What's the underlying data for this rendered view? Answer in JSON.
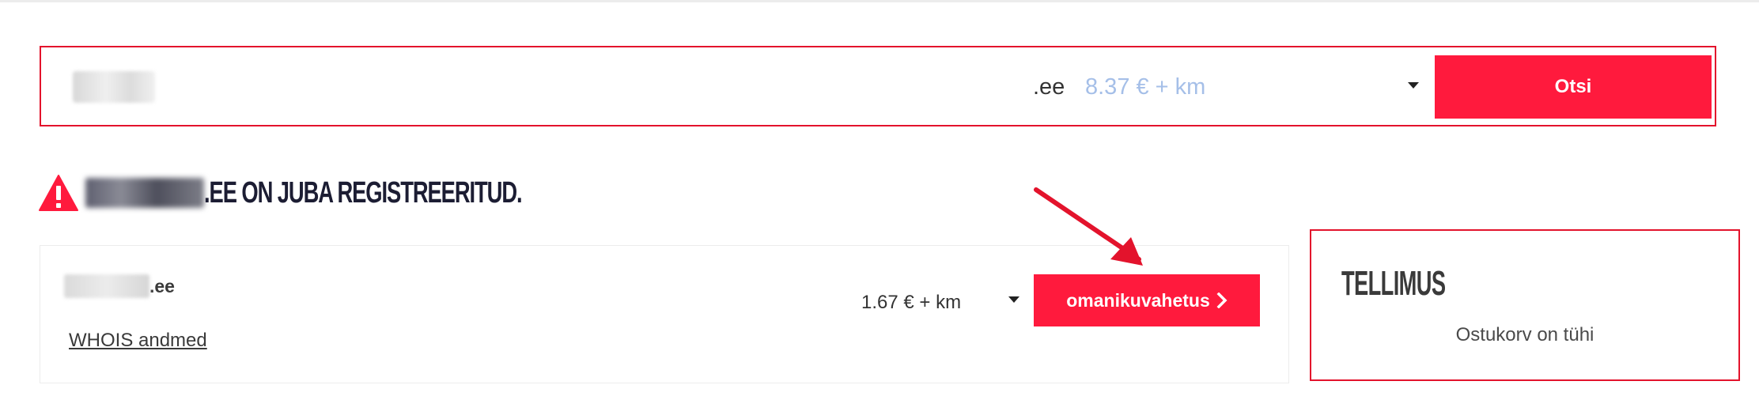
{
  "search": {
    "tld": ".ee",
    "tld_price": "8.37 € + km",
    "button_label": "Otsi"
  },
  "result": {
    "heading_suffix": ".EE ON JUBA REGISTREERITUD.",
    "domain_tld": ".ee",
    "whois_link": "WHOIS andmed",
    "price": "1.67 € + km",
    "action_label": "omanikuvahetus"
  },
  "order": {
    "title": "TELLIMUS",
    "empty_text": "Ostukorv on tühi"
  },
  "icons": {
    "warning": "warning-triangle-icon",
    "dropdown": "caret-down-icon",
    "chevron": "chevron-right-icon"
  },
  "colors": {
    "accent": "#ff1a3d",
    "annotation_border": "#e3132c",
    "price_muted": "#a5bfe8",
    "heading": "#1c1d33"
  }
}
